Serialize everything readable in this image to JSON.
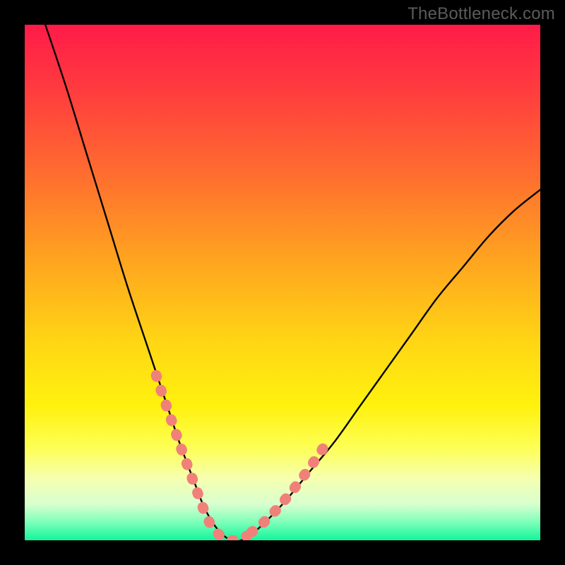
{
  "watermark": "TheBottleneck.com",
  "gradient_stops": [
    {
      "offset": 0.0,
      "color": "#ff1b49"
    },
    {
      "offset": 0.12,
      "color": "#ff3a3f"
    },
    {
      "offset": 0.28,
      "color": "#ff6a30"
    },
    {
      "offset": 0.45,
      "color": "#ffa220"
    },
    {
      "offset": 0.62,
      "color": "#ffd714"
    },
    {
      "offset": 0.74,
      "color": "#fff20e"
    },
    {
      "offset": 0.82,
      "color": "#fdff55"
    },
    {
      "offset": 0.88,
      "color": "#f6ffb0"
    },
    {
      "offset": 0.93,
      "color": "#d8ffcf"
    },
    {
      "offset": 0.965,
      "color": "#7dffb9"
    },
    {
      "offset": 1.0,
      "color": "#11f59a"
    }
  ],
  "curve_color": "#000000",
  "curve_width": 2.4,
  "overlay_color": "#f08179",
  "overlay_width": 15,
  "chart_data": {
    "type": "line",
    "title": "",
    "xlabel": "",
    "ylabel": "",
    "xlim": [
      0,
      100
    ],
    "ylim": [
      0,
      100
    ],
    "series": [
      {
        "name": "bottleneck-curve",
        "x": [
          4,
          8,
          12,
          16,
          20,
          24,
          28,
          30,
          33,
          35,
          37.5,
          40,
          42,
          45,
          50,
          55,
          60,
          65,
          70,
          75,
          80,
          85,
          90,
          95,
          100
        ],
        "y": [
          100,
          88,
          75,
          62,
          49,
          37,
          25,
          19,
          11,
          6,
          2,
          0,
          0,
          2,
          7,
          13,
          19,
          26,
          33,
          40,
          47,
          53,
          59,
          64,
          68
        ]
      }
    ],
    "overlay_segments": [
      {
        "name": "left-dotted-overlay",
        "x": [
          25.5,
          26.3,
          27.5,
          28.8,
          30.0,
          31.2,
          32.3,
          33.3,
          34.2,
          35.0,
          36.0,
          37.2,
          38.5,
          40.0,
          41.5,
          43.0
        ],
        "y": [
          32.0,
          29.5,
          26.0,
          22.3,
          18.8,
          15.5,
          12.5,
          9.8,
          7.4,
          5.2,
          3.2,
          1.6,
          0.5,
          0.0,
          0.0,
          0.8
        ]
      },
      {
        "name": "right-dotted-overlay",
        "x": [
          44.0,
          45.5,
          47.0,
          48.5,
          50.0,
          51.5,
          53.0,
          54.5,
          56.0,
          57.5,
          59.0
        ],
        "y": [
          1.6,
          2.7,
          4.1,
          5.6,
          7.3,
          9.1,
          11.0,
          13.0,
          15.1,
          17.3,
          19.5
        ]
      }
    ]
  }
}
